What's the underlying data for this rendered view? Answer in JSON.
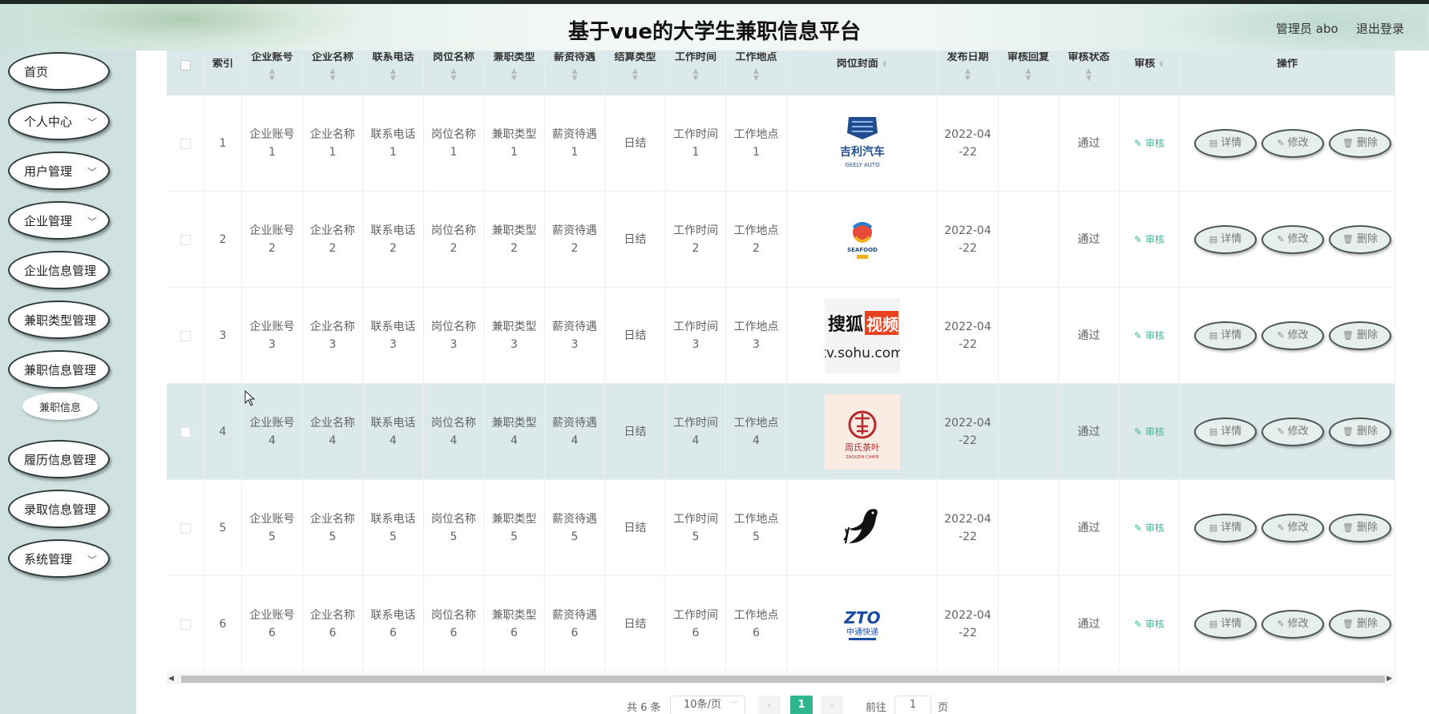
{
  "header": {
    "title": "基于vue的大学生兼职信息平台",
    "admin": "管理员 abo",
    "logout": "退出登录"
  },
  "sidebar": {
    "items": [
      {
        "label": "首页",
        "arrow": false
      },
      {
        "label": "个人中心",
        "arrow": true
      },
      {
        "label": "用户管理",
        "arrow": true
      },
      {
        "label": "企业管理",
        "arrow": true
      },
      {
        "label": "企业信息管理",
        "arrow": false
      },
      {
        "label": "兼职类型管理",
        "arrow": false
      },
      {
        "label": "兼职信息管理",
        "arrow": false
      },
      {
        "label": "履历信息管理",
        "arrow": false
      },
      {
        "label": "录取信息管理",
        "arrow": false
      },
      {
        "label": "系统管理",
        "arrow": true
      }
    ],
    "subitem": "兼职信息"
  },
  "table": {
    "columns": {
      "index": "索引",
      "account": "企业账号",
      "company": "企业名称",
      "phone": "联系电话",
      "position": "岗位名称",
      "type": "兼职类型",
      "salary": "薪资待遇",
      "settle": "结算类型",
      "worktime": "工作时间",
      "place": "工作地点",
      "cover": "岗位封面",
      "date": "发布日期",
      "reply": "审核回复",
      "status": "审核状态",
      "audit": "审核",
      "ops": "操作"
    },
    "rows": [
      {
        "index": "1",
        "account": [
          "企业账号",
          "1"
        ],
        "company": [
          "企业名称",
          "1"
        ],
        "phone": [
          "联系电话",
          "1"
        ],
        "position": [
          "岗位名称",
          "1"
        ],
        "type": [
          "兼职类型",
          "1"
        ],
        "salary": [
          "薪资待遇",
          "1"
        ],
        "settle": "日结",
        "worktime": [
          "工作时间",
          "1"
        ],
        "place": [
          "工作地点",
          "1"
        ],
        "logo": "geely-logo",
        "logo_text": "吉利汽车",
        "logo_sub": "GEELY AUTO",
        "date": [
          "2022-04",
          "-22"
        ],
        "reply": "",
        "status": "通过",
        "audit": "审核"
      },
      {
        "index": "2",
        "account": [
          "企业账号",
          "2"
        ],
        "company": [
          "企业名称",
          "2"
        ],
        "phone": [
          "联系电话",
          "2"
        ],
        "position": [
          "岗位名称",
          "2"
        ],
        "type": [
          "兼职类型",
          "2"
        ],
        "salary": [
          "薪资待遇",
          "2"
        ],
        "settle": "日结",
        "worktime": [
          "工作时间",
          "2"
        ],
        "place": [
          "工作地点",
          "2"
        ],
        "logo": "seafood-logo",
        "logo_text": "SEAFOOD",
        "logo_sub": "",
        "date": [
          "2022-04",
          "-22"
        ],
        "reply": "",
        "status": "通过",
        "audit": "审核"
      },
      {
        "index": "3",
        "account": [
          "企业账号",
          "3"
        ],
        "company": [
          "企业名称",
          "3"
        ],
        "phone": [
          "联系电话",
          "3"
        ],
        "position": [
          "岗位名称",
          "3"
        ],
        "type": [
          "兼职类型",
          "3"
        ],
        "salary": [
          "薪资待遇",
          "3"
        ],
        "settle": "日结",
        "worktime": [
          "工作时间",
          "3"
        ],
        "place": [
          "工作地点",
          "3"
        ],
        "logo": "sohu-video-logo",
        "logo_text": "搜狐视频",
        "logo_sub": "tv.sohu.com",
        "date": [
          "2022-04",
          "-22"
        ],
        "reply": "",
        "status": "通过",
        "audit": "审核"
      },
      {
        "index": "4",
        "account": [
          "企业账号",
          "4"
        ],
        "company": [
          "企业名称",
          "4"
        ],
        "phone": [
          "联系电话",
          "4"
        ],
        "position": [
          "岗位名称",
          "4"
        ],
        "type": [
          "兼职类型",
          "4"
        ],
        "salary": [
          "薪资待遇",
          "4"
        ],
        "settle": "日结",
        "worktime": [
          "工作时间",
          "4"
        ],
        "place": [
          "工作地点",
          "4"
        ],
        "logo": "zhoushi-tea-logo",
        "logo_text": "周氏茶叶",
        "logo_sub": "ZHOUZHI CHAYE",
        "date": [
          "2022-04",
          "-22"
        ],
        "reply": "",
        "status": "通过",
        "audit": "审核"
      },
      {
        "index": "5",
        "account": [
          "企业账号",
          "5"
        ],
        "company": [
          "企业名称",
          "5"
        ],
        "phone": [
          "联系电话",
          "5"
        ],
        "position": [
          "岗位名称",
          "5"
        ],
        "type": [
          "兼职类型",
          "5"
        ],
        "salary": [
          "薪资待遇",
          "5"
        ],
        "settle": "日结",
        "worktime": [
          "工作时间",
          "5"
        ],
        "place": [
          "工作地点",
          "5"
        ],
        "logo": "bird-logo",
        "logo_text": "",
        "logo_sub": "",
        "date": [
          "2022-04",
          "-22"
        ],
        "reply": "",
        "status": "通过",
        "audit": "审核"
      },
      {
        "index": "6",
        "account": [
          "企业账号",
          "6"
        ],
        "company": [
          "企业名称",
          "6"
        ],
        "phone": [
          "联系电话",
          "6"
        ],
        "position": [
          "岗位名称",
          "6"
        ],
        "type": [
          "兼职类型",
          "6"
        ],
        "salary": [
          "薪资待遇",
          "6"
        ],
        "settle": "日结",
        "worktime": [
          "工作时间",
          "6"
        ],
        "place": [
          "工作地点",
          "6"
        ],
        "logo": "zto-logo",
        "logo_text": "ZTO",
        "logo_sub": "中通快递",
        "date": [
          "2022-04",
          "-22"
        ],
        "reply": "",
        "status": "通过",
        "audit": "审核"
      }
    ],
    "buttons": {
      "detail": "详情",
      "edit": "修改",
      "delete": "删除"
    },
    "hover_row": 4
  },
  "pagination": {
    "total": "共 6 条",
    "page_size": "10条/页",
    "current": "1",
    "goto_prefix": "前往",
    "goto_value": "1",
    "goto_suffix": "页"
  },
  "colors": {
    "accent": "#2fb68e",
    "sidebar_bg": "#cfe1e1",
    "table_header_bg": "#dce9ea"
  }
}
